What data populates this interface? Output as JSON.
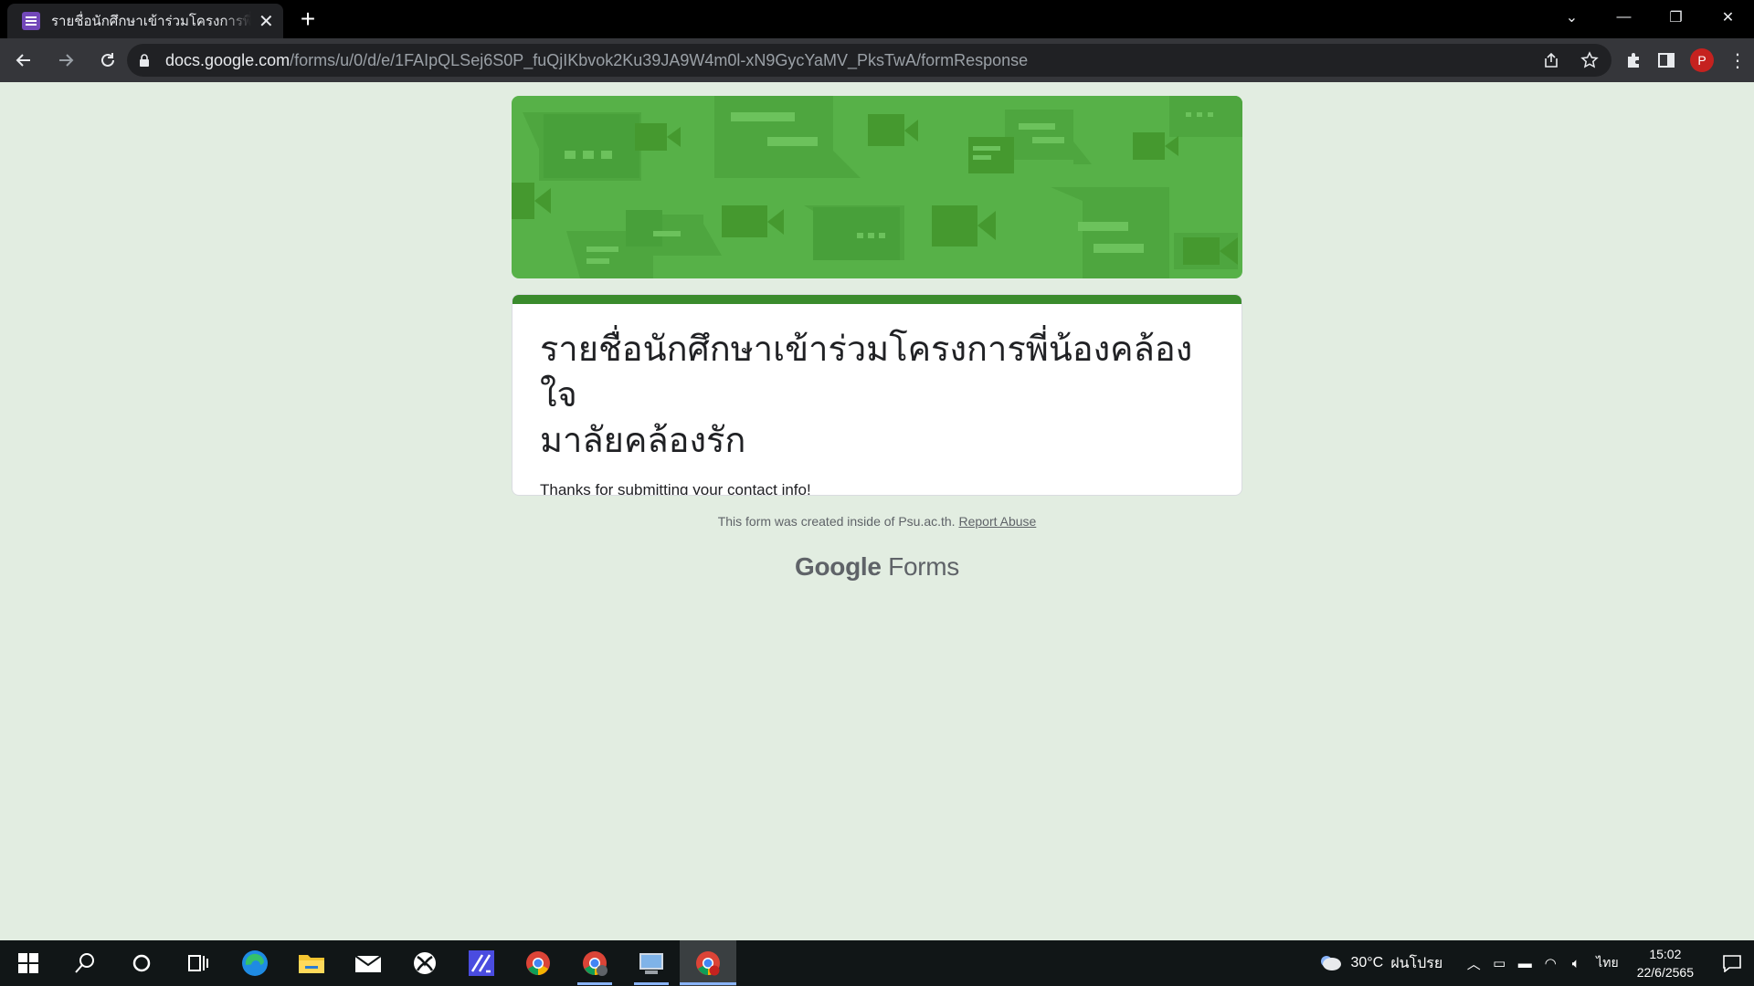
{
  "browser": {
    "tab_title": "รายชื่อนักศึกษาเข้าร่วมโครงการพี่น้องคล้องใจมาลัยคล้องรัก",
    "tab_close": "✕",
    "new_tab": "+",
    "url_host": "docs.google.com",
    "url_path": "/forms/u/0/d/e/1FAIpQLSej6S0P_fuQjIKbvok2Ku39JA9W4m0l-xN9GycYaMV_PksTwA/formResponse",
    "profile_initial": "P",
    "menu_glyph": "⋮"
  },
  "form": {
    "title_line1": "รายชื่อนักศึกษาเข้าร่วมโครงการพี่น้องคล้องใจ",
    "title_line2": "มาลัยคล้องรัก",
    "confirmation": "Thanks for submitting your contact info!",
    "footer_text": "This form was created inside of Psu.ac.th.",
    "report_abuse": "Report Abuse",
    "brand_google": "Google",
    "brand_forms": "Forms",
    "accent_color": "#3a8b2c",
    "banner_color": "#57b148",
    "background_color": "#e2ede1"
  },
  "taskbar": {
    "apps": [
      "start-icon",
      "search-icon",
      "cortana-icon",
      "task-view-icon",
      "edge-icon",
      "file-explorer-icon",
      "mail-icon",
      "xbox-icon",
      "affinity-icon",
      "chrome-icon",
      "chrome-profile-icon",
      "control-panel-icon",
      "chrome-active-icon"
    ],
    "temperature": "30°C",
    "weather": "ฝนโปรย",
    "language": "ไทย",
    "time": "15:02",
    "date": "22/6/2565"
  }
}
